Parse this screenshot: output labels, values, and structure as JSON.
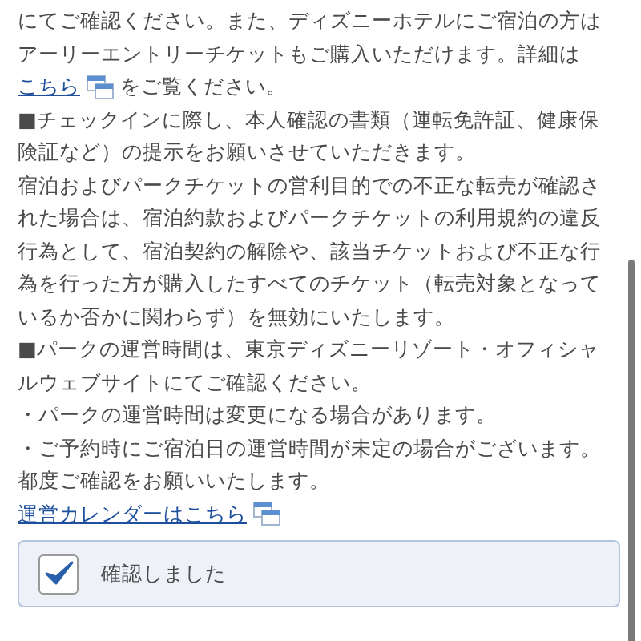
{
  "intro": "にてご確認ください。また、ディズニーホテルにご宿泊の方はアーリーエントリーチケットもご購入いただけます。詳細は",
  "intro_link": {
    "label": "こちら",
    "after": "をご覧ください。"
  },
  "paragraphs": [
    "■チェックインに際し、本人確認の書類（運転免許証、健康保険証など）の提示をお願いさせていただきます。",
    "宿泊およびパークチケットの営利目的での不正な転売が確認された場合は、宿泊約款およびパークチケットの利用規約の違反行為として、宿泊契約の解除や、該当チケットおよび不正な行為を行った方が購入したすべてのチケット（転売対象となっているか否かに関わらず）を無効にいたします。",
    "■パークの運営時間は、東京ディズニーリゾート・オフィシャルウェブサイトにてご確認ください。",
    "・パークの運営時間は変更になる場合があります。",
    "・ご予約時にご宿泊日の運営時間が未定の場合がございます。都度ご確認をお願いいたします。"
  ],
  "calendar_link": "運営カレンダーはこちら",
  "confirm": {
    "label": "確認しました",
    "checked": true
  }
}
